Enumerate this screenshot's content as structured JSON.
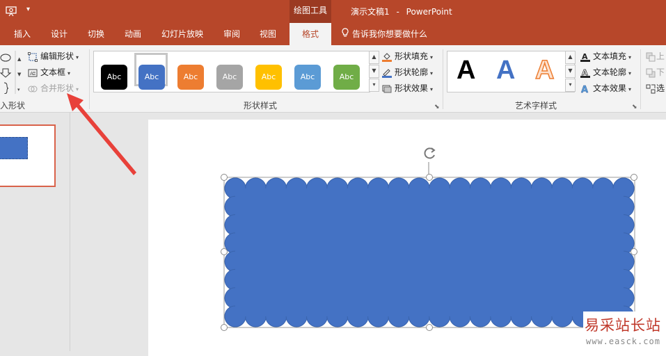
{
  "app": {
    "context_tool": "绘图工具",
    "doc_title": "演示文稿1",
    "title_sep": "-",
    "app_name": "PowerPoint"
  },
  "tabs": [
    {
      "label": "插入"
    },
    {
      "label": "设计"
    },
    {
      "label": "切换"
    },
    {
      "label": "动画"
    },
    {
      "label": "幻灯片放映"
    },
    {
      "label": "审阅"
    },
    {
      "label": "视图"
    },
    {
      "label": "格式"
    }
  ],
  "tell_me": "告诉我你想要做什么",
  "insert_shapes": {
    "edit_shape": "编辑形状",
    "text_box": "文本框",
    "merge_shapes": "合并形状",
    "group_label": "入形状"
  },
  "shape_styles": {
    "group_label": "形状样式",
    "presets": [
      {
        "label": "Abc",
        "color": "#000000"
      },
      {
        "label": "Abc",
        "color": "#4472c4"
      },
      {
        "label": "Abc",
        "color": "#ed7d31"
      },
      {
        "label": "Abc",
        "color": "#a5a5a5"
      },
      {
        "label": "Abc",
        "color": "#ffc000"
      },
      {
        "label": "Abc",
        "color": "#5b9bd5"
      },
      {
        "label": "Abc",
        "color": "#70ad47"
      }
    ],
    "shape_fill": "形状填充",
    "shape_outline": "形状轮廓",
    "shape_effects": "形状效果"
  },
  "wordart": {
    "group_label": "艺术字样式",
    "samples": [
      "A",
      "A",
      "A"
    ],
    "text_fill": "文本填充",
    "text_outline": "文本轮廓",
    "text_effects": "文本效果"
  },
  "arrange_partial": [
    "上",
    "下",
    "选"
  ],
  "watermark": {
    "title": "易采站长站",
    "url": "www.easck.com"
  },
  "colors": {
    "brand": "#b7472a",
    "shape_fill": "#4472c4",
    "annotation_arrow": "#e8413a"
  }
}
